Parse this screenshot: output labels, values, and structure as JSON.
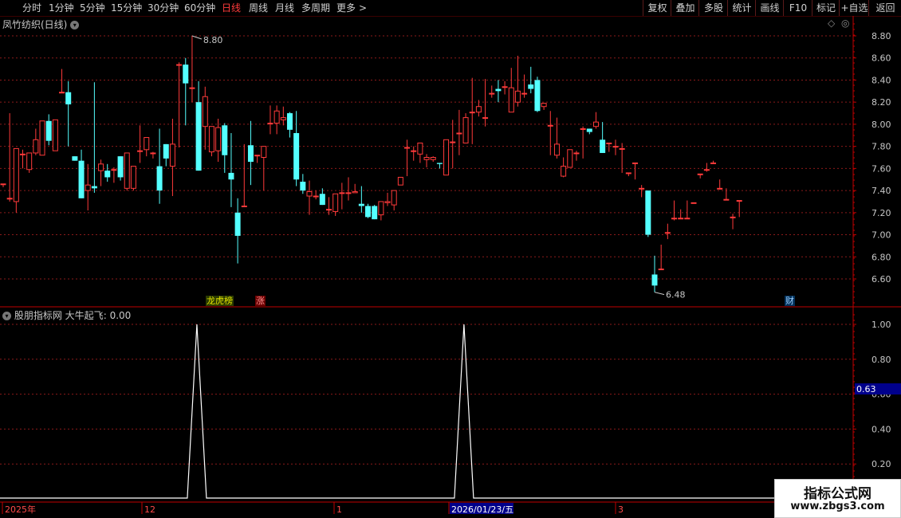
{
  "toolbar": {
    "periods": [
      "分时",
      "1分钟",
      "5分钟",
      "15分钟",
      "30分钟",
      "60分钟",
      "日线",
      "周线",
      "月线",
      "多周期",
      "更多"
    ],
    "active_period": "日线",
    "more_arrow": ">",
    "buttons": [
      "复权",
      "叠加",
      "多股",
      "统计",
      "画线",
      "F10",
      "标记",
      "+自选",
      "返回"
    ]
  },
  "main_panel": {
    "title": "凤竹纺织(日线)",
    "high_label": "8.80",
    "low_label": "6.48",
    "tags": [
      "龙虎榜",
      "涨",
      "财"
    ]
  },
  "indicator_panel": {
    "title": "股朋指标网",
    "name": "大牛起飞",
    "value": "0.00",
    "cursor_value": "0.63"
  },
  "time_axis": {
    "labels": [
      "2025年",
      "12",
      "1",
      "2026/01/23/五",
      "3"
    ]
  },
  "watermark": {
    "line1": "指标公式网",
    "line2": "www.zbgs3.com"
  },
  "colors": {
    "up": "#ff3a3a",
    "down": "#54ffff",
    "grid": "#8b1a1a",
    "axis": "#c00000",
    "indicator_line": "#ffffff"
  },
  "chart_data": [
    {
      "type": "candlestick",
      "title": "凤竹纺织(日线)",
      "ylim": [
        6.45,
        8.95
      ],
      "yticks": [
        6.6,
        6.8,
        7.0,
        7.2,
        7.4,
        7.6,
        7.8,
        8.0,
        8.2,
        8.4,
        8.6,
        8.8
      ],
      "candles": [
        [
          7.46,
          7.46,
          7.46,
          7.43
        ],
        [
          7.33,
          7.33,
          8.1,
          7.3
        ],
        [
          7.3,
          7.78,
          7.78,
          7.2
        ],
        [
          7.73,
          7.73,
          7.77,
          7.6
        ],
        [
          7.59,
          7.74,
          7.74,
          7.56
        ],
        [
          7.74,
          7.86,
          7.96,
          7.72
        ],
        [
          7.72,
          8.03,
          8.03,
          7.72
        ],
        [
          8.03,
          7.85,
          8.09,
          7.81
        ],
        [
          7.76,
          8.04,
          8.04,
          7.76
        ],
        [
          8.29,
          8.29,
          8.5,
          8.29
        ],
        [
          8.29,
          8.18,
          8.39,
          7.8
        ],
        [
          7.71,
          7.67,
          7.71,
          7.67
        ],
        [
          7.67,
          7.33,
          7.77,
          7.33
        ],
        [
          7.4,
          7.45,
          7.64,
          7.22
        ],
        [
          7.44,
          7.42,
          8.38,
          7.38
        ],
        [
          7.58,
          7.64,
          7.68,
          7.44
        ],
        [
          7.58,
          7.52,
          7.64,
          7.48
        ],
        [
          7.59,
          7.59,
          7.61,
          7.47
        ],
        [
          7.71,
          7.52,
          7.71,
          7.49
        ],
        [
          7.42,
          7.74,
          7.74,
          7.4
        ],
        [
          7.42,
          7.62,
          7.62,
          7.4
        ],
        [
          7.76,
          7.76,
          7.99,
          7.65
        ],
        [
          7.77,
          7.88,
          7.88,
          7.71
        ],
        [
          7.74,
          7.74,
          7.75,
          7.69
        ],
        [
          7.62,
          7.4,
          7.96,
          7.28
        ],
        [
          7.82,
          7.69,
          7.82,
          7.62
        ],
        [
          7.62,
          7.82,
          8.05,
          7.35
        ],
        [
          8.54,
          8.54,
          8.56,
          7.79
        ],
        [
          8.54,
          8.37,
          8.6,
          7.99
        ],
        [
          8.33,
          8.33,
          8.8,
          8.2
        ],
        [
          8.2,
          7.58,
          8.39,
          7.58
        ],
        [
          7.98,
          8.25,
          8.34,
          7.77
        ],
        [
          7.75,
          7.98,
          7.98,
          7.71
        ],
        [
          7.76,
          7.97,
          8.05,
          7.66
        ],
        [
          7.99,
          7.72,
          8.01,
          7.56
        ],
        [
          7.56,
          7.5,
          7.92,
          7.25
        ],
        [
          7.2,
          6.99,
          7.33,
          6.74
        ],
        [
          7.26,
          7.26,
          7.82,
          7.26
        ],
        [
          7.81,
          7.66,
          8.03,
          7.45
        ],
        [
          7.72,
          7.72,
          7.72,
          7.65
        ],
        [
          7.7,
          7.8,
          7.8,
          7.4
        ],
        [
          8.01,
          8.01,
          8.17,
          7.91
        ],
        [
          8.01,
          8.12,
          8.17,
          7.91
        ],
        [
          8.04,
          8.06,
          8.16,
          7.99
        ],
        [
          8.1,
          7.95,
          8.11,
          7.88
        ],
        [
          7.92,
          7.5,
          8.12,
          7.44
        ],
        [
          7.48,
          7.4,
          7.55,
          7.37
        ],
        [
          7.35,
          7.39,
          7.49,
          7.18
        ],
        [
          7.35,
          7.35,
          7.4,
          7.32
        ],
        [
          7.37,
          7.27,
          7.42,
          7.27
        ],
        [
          7.23,
          7.23,
          7.34,
          7.18
        ],
        [
          7.21,
          7.37,
          7.37,
          7.17
        ],
        [
          7.38,
          7.38,
          7.47,
          7.23
        ],
        [
          7.38,
          7.38,
          7.52,
          7.31
        ],
        [
          7.38,
          7.39,
          7.46,
          7.38
        ],
        [
          7.28,
          7.26,
          7.44,
          7.2
        ],
        [
          7.26,
          7.16,
          7.28,
          7.15
        ],
        [
          7.26,
          7.14,
          7.27,
          7.14
        ],
        [
          7.18,
          7.3,
          7.3,
          7.13
        ],
        [
          7.29,
          7.3,
          7.38,
          7.26
        ],
        [
          7.27,
          7.4,
          7.4,
          7.22
        ],
        [
          7.45,
          7.52,
          7.52,
          7.47
        ],
        [
          7.79,
          7.79,
          7.86,
          7.53
        ],
        [
          7.76,
          7.76,
          7.8,
          7.67
        ],
        [
          7.73,
          7.83,
          7.83,
          7.65
        ],
        [
          7.68,
          7.7,
          7.73,
          7.61
        ],
        [
          7.68,
          7.7,
          7.71,
          7.66
        ],
        [
          7.65,
          7.64,
          7.62,
          7.6
        ],
        [
          7.54,
          7.86,
          7.86,
          7.54
        ],
        [
          7.84,
          7.84,
          8.04,
          7.6
        ],
        [
          7.92,
          7.92,
          8.13,
          7.72
        ],
        [
          7.83,
          8.06,
          8.1,
          7.83
        ],
        [
          8.11,
          8.11,
          8.42,
          7.82
        ],
        [
          8.11,
          8.16,
          8.22,
          8.07
        ],
        [
          8.06,
          8.06,
          8.41,
          7.98
        ],
        [
          8.28,
          8.28,
          8.35,
          8.24
        ],
        [
          8.32,
          8.3,
          8.4,
          8.2
        ],
        [
          8.34,
          8.34,
          8.39,
          8.27
        ],
        [
          8.11,
          8.33,
          8.51,
          8.11
        ],
        [
          8.2,
          8.3,
          8.62,
          8.16
        ],
        [
          8.28,
          8.28,
          8.45,
          8.24
        ],
        [
          8.36,
          8.32,
          8.52,
          8.28
        ],
        [
          8.4,
          8.12,
          8.43,
          8.11
        ],
        [
          8.16,
          8.19,
          8.18,
          8.13
        ],
        [
          7.99,
          7.99,
          8.12,
          7.72
        ],
        [
          7.72,
          7.82,
          8.06,
          7.69
        ],
        [
          7.53,
          7.62,
          7.7,
          7.52
        ],
        [
          7.61,
          7.77,
          7.77,
          7.64
        ],
        [
          7.74,
          7.74,
          7.76,
          7.67
        ],
        [
          7.96,
          7.96,
          7.98,
          7.69
        ],
        [
          7.96,
          7.93,
          7.92,
          7.91
        ],
        [
          7.98,
          8.02,
          8.11,
          7.96
        ],
        [
          7.86,
          7.74,
          8.02,
          7.8
        ],
        [
          7.83,
          7.83,
          7.83,
          7.75
        ],
        [
          7.8,
          7.8,
          7.86,
          7.72
        ],
        [
          7.78,
          7.78,
          7.83,
          7.56
        ],
        [
          7.56,
          7.56,
          7.56,
          7.53
        ],
        [
          7.65,
          7.65,
          7.56,
          7.5
        ],
        [
          7.42,
          7.42,
          7.45,
          7.34
        ],
        [
          7.4,
          7.0,
          7.4,
          6.98
        ],
        [
          6.64,
          6.54,
          6.81,
          6.48
        ],
        [
          6.69,
          6.69,
          6.91,
          6.78
        ],
        [
          7.02,
          7.02,
          7.1,
          6.96
        ],
        [
          7.15,
          7.15,
          7.31,
          7.13
        ],
        [
          7.15,
          7.15,
          7.23,
          7.2
        ],
        [
          7.15,
          7.15,
          7.31,
          7.23
        ],
        [
          7.29,
          7.29,
          7.29,
          7.29
        ],
        [
          7.55,
          7.55,
          7.55,
          7.51
        ],
        [
          7.59,
          7.59,
          7.65,
          7.57
        ],
        [
          7.65,
          7.65,
          7.67,
          7.64
        ],
        [
          7.42,
          7.42,
          7.5,
          7.41
        ],
        [
          7.32,
          7.32,
          7.42,
          7.34
        ],
        [
          7.16,
          7.16,
          7.19,
          7.05
        ],
        [
          7.31,
          7.31,
          7.29,
          7.16
        ]
      ],
      "high_marker": 8.8,
      "low_marker": 6.48
    },
    {
      "type": "line",
      "title": "股朋指标网 大牛起飞",
      "ylim": [
        0.0,
        1.0
      ],
      "yticks": [
        0.2,
        0.4,
        0.6,
        0.8,
        1.0
      ],
      "series": [
        {
          "name": "大牛起飞",
          "peaks_at_candle": [
            29,
            70
          ],
          "values_description_free": true
        }
      ]
    }
  ]
}
